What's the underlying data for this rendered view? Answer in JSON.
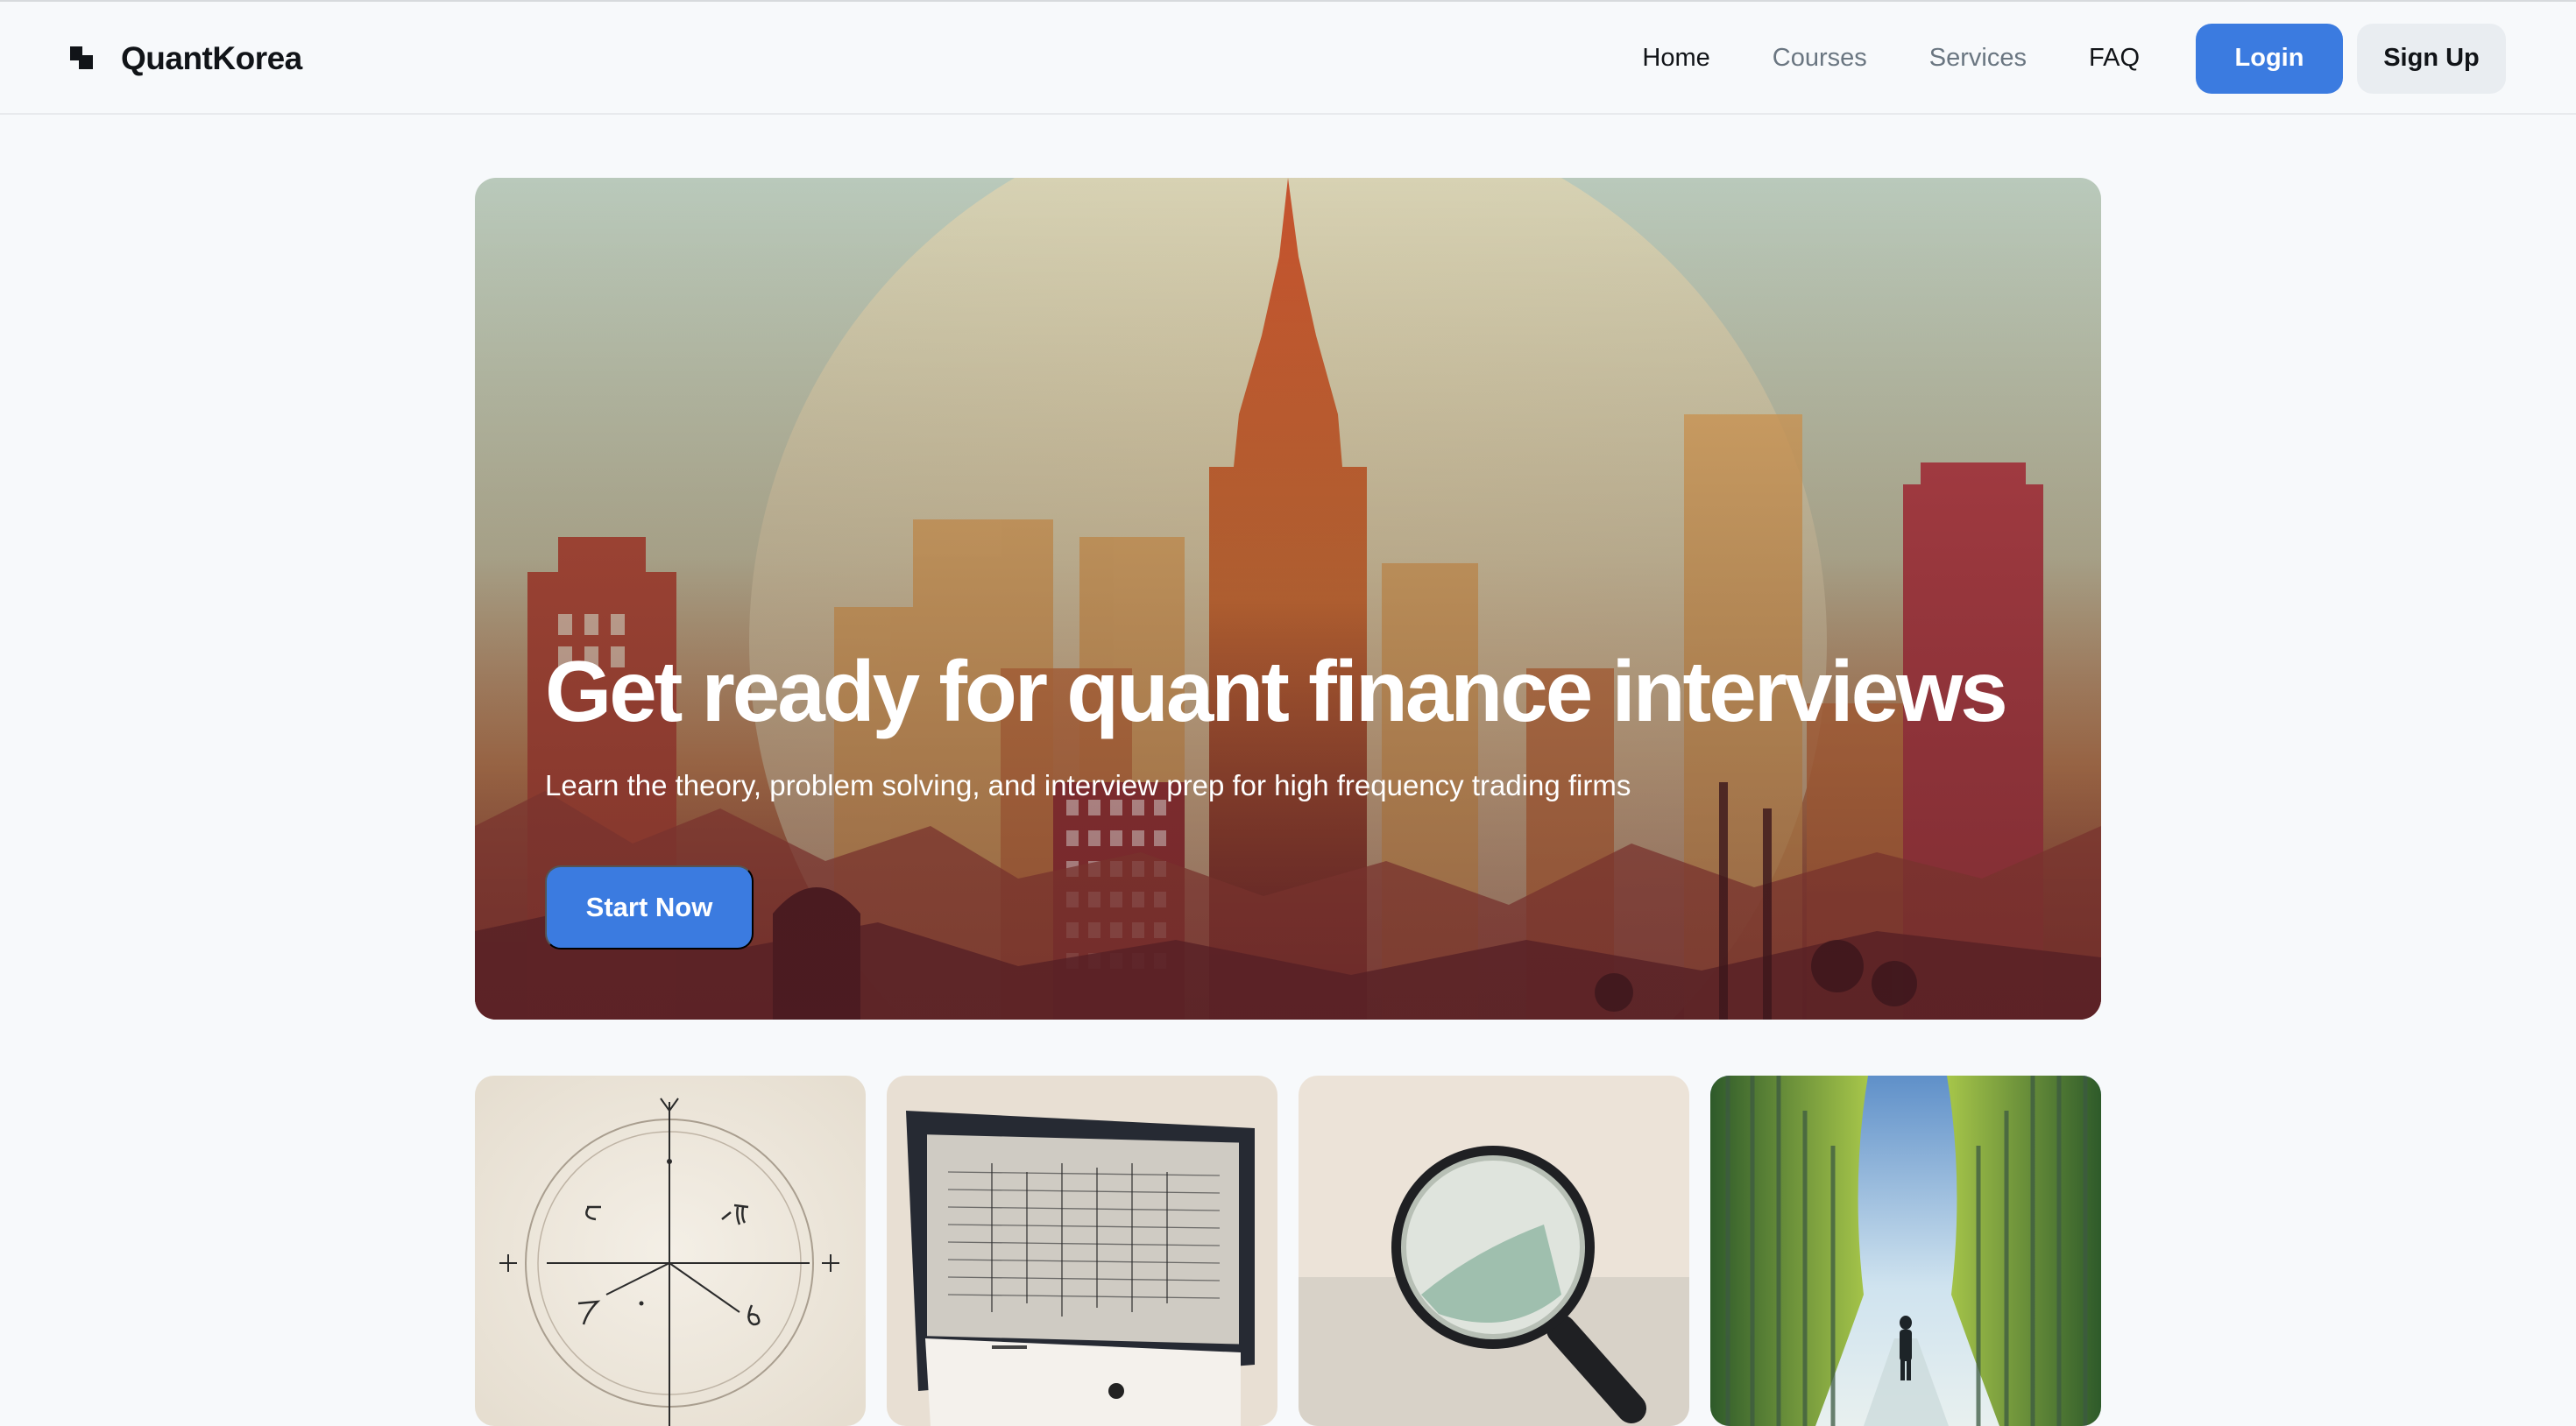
{
  "brand": {
    "name": "QuantKorea",
    "logo_icon": "quantkorea-logo-icon"
  },
  "nav": {
    "links": [
      {
        "label": "Home",
        "active": true
      },
      {
        "label": "Courses",
        "active": false
      },
      {
        "label": "Services",
        "active": false
      },
      {
        "label": "FAQ",
        "active": false
      }
    ],
    "login_label": "Login",
    "signup_label": "Sign Up"
  },
  "hero": {
    "title": "Get ready for quant finance interviews",
    "subtitle": "Learn the theory, problem solving, and interview prep for high frequency trading firms",
    "cta_label": "Start Now",
    "image": "city-skyline-illustration"
  },
  "cards": [
    {
      "image": "math-axes-sketch-illustration"
    },
    {
      "image": "computer-monitor-data-illustration"
    },
    {
      "image": "magnifying-glass-illustration"
    },
    {
      "image": "forest-path-person-illustration"
    }
  ],
  "colors": {
    "accent": "#3b7be0",
    "background": "#f7f9fb",
    "text": "#111418",
    "muted_text": "#6a7681",
    "secondary_button": "#e9edf1"
  }
}
